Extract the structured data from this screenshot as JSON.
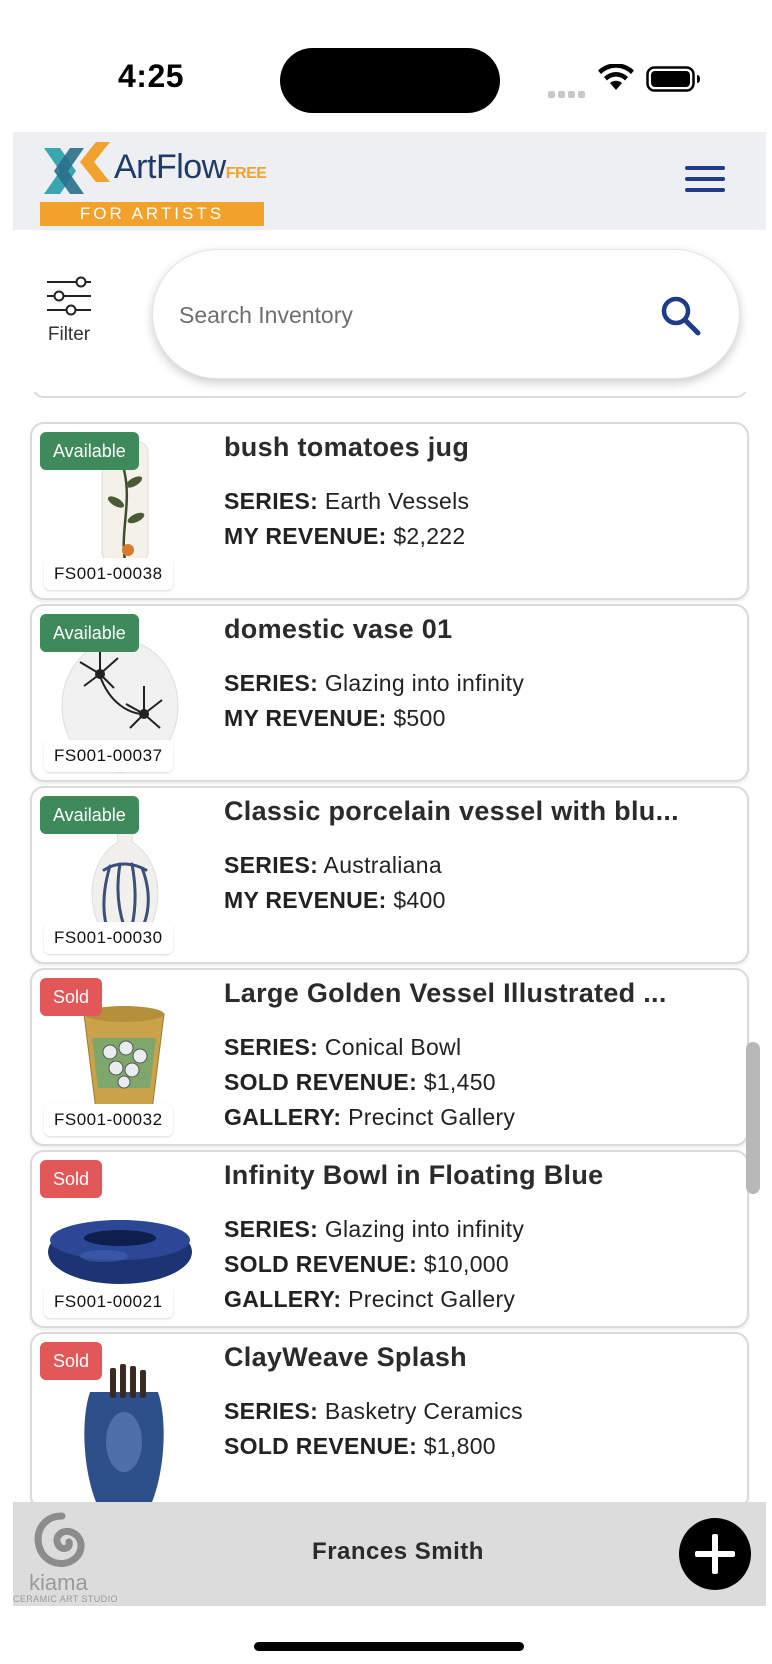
{
  "status_bar": {
    "time": "4:25"
  },
  "header": {
    "logo_name": "ArtFlow",
    "logo_tag": "FREE",
    "logo_subtitle": "FOR ARTISTS"
  },
  "toolbar": {
    "filter_label": "Filter",
    "search_placeholder": "Search Inventory"
  },
  "inventory": [
    {
      "status": "Available",
      "sku": "FS001-00038",
      "title": "bush tomatoes jug",
      "rows": [
        {
          "label": "SERIES:",
          "value": "Earth Vessels"
        },
        {
          "label": "MY REVENUE:",
          "value": "$2,222"
        }
      ]
    },
    {
      "status": "Available",
      "sku": "FS001-00037",
      "title": "domestic vase 01",
      "rows": [
        {
          "label": "SERIES:",
          "value": "Glazing into infinity"
        },
        {
          "label": "MY REVENUE:",
          "value": "$500"
        }
      ]
    },
    {
      "status": "Available",
      "sku": "FS001-00030",
      "title": "Classic porcelain vessel with blu...",
      "rows": [
        {
          "label": "SERIES:",
          "value": "Australiana"
        },
        {
          "label": "MY REVENUE:",
          "value": "$400"
        }
      ]
    },
    {
      "status": "Sold",
      "sku": "FS001-00032",
      "title": "Large Golden Vessel Illustrated ...",
      "rows": [
        {
          "label": "SERIES:",
          "value": "Conical Bowl"
        },
        {
          "label": "SOLD REVENUE:",
          "value": "$1,450"
        },
        {
          "label": "GALLERY:",
          "value": "Precinct Gallery"
        }
      ]
    },
    {
      "status": "Sold",
      "sku": "FS001-00021",
      "title": "Infinity Bowl in Floating Blue",
      "rows": [
        {
          "label": "SERIES:",
          "value": "Glazing into infinity"
        },
        {
          "label": "SOLD REVENUE:",
          "value": "$10,000"
        },
        {
          "label": "GALLERY:",
          "value": "Precinct Gallery"
        }
      ]
    },
    {
      "status": "Sold",
      "sku": "",
      "title": "ClayWeave Splash",
      "rows": [
        {
          "label": "SERIES:",
          "value": "Basketry Ceramics"
        },
        {
          "label": "SOLD REVENUE:",
          "value": "$1,800"
        }
      ]
    }
  ],
  "footer": {
    "studio_name": "kiama",
    "studio_subtitle": "CERAMIC ART STUDIO",
    "user_name": "Frances Smith"
  },
  "colors": {
    "available": "#3e8a5a",
    "sold": "#e25757",
    "brand_navy": "#1f3c67",
    "brand_orange": "#f3a12d"
  }
}
